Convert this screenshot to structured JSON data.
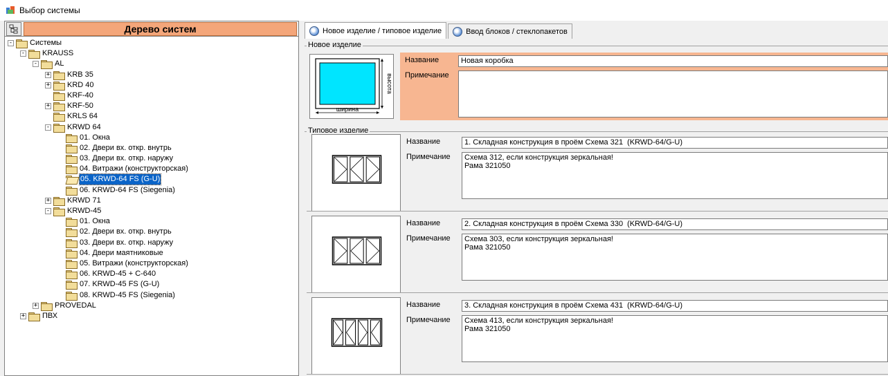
{
  "window": {
    "title": "Выбор системы"
  },
  "tree": {
    "header_title": "Дерево систем",
    "nodes": [
      {
        "label": "Системы",
        "depth": 0,
        "expander": "-",
        "folder": "closed"
      },
      {
        "label": "KRAUSS",
        "depth": 1,
        "expander": "-",
        "folder": "closed"
      },
      {
        "label": "AL",
        "depth": 2,
        "expander": "-",
        "folder": "closed"
      },
      {
        "label": "KRB 35",
        "depth": 3,
        "expander": "+",
        "folder": "closed"
      },
      {
        "label": "KRD 40",
        "depth": 3,
        "expander": "+",
        "folder": "closed"
      },
      {
        "label": "KRF-40",
        "depth": 3,
        "expander": "",
        "folder": "closed"
      },
      {
        "label": "KRF-50",
        "depth": 3,
        "expander": "+",
        "folder": "closed"
      },
      {
        "label": "KRLS 64",
        "depth": 3,
        "expander": "",
        "folder": "closed"
      },
      {
        "label": "KRWD 64",
        "depth": 3,
        "expander": "-",
        "folder": "closed"
      },
      {
        "label": "01. Окна",
        "depth": 4,
        "expander": "",
        "folder": "closed"
      },
      {
        "label": "02. Двери вх. откр. внутрь",
        "depth": 4,
        "expander": "",
        "folder": "closed"
      },
      {
        "label": "03. Двери вх. откр. наружу",
        "depth": 4,
        "expander": "",
        "folder": "closed"
      },
      {
        "label": "04. Витражи (конструкторская)",
        "depth": 4,
        "expander": "",
        "folder": "closed"
      },
      {
        "label": "05. KRWD-64 FS (G-U)",
        "depth": 4,
        "expander": "",
        "folder": "open",
        "selected": true
      },
      {
        "label": "06. KRWD-64 FS (Siegenia)",
        "depth": 4,
        "expander": "",
        "folder": "closed"
      },
      {
        "label": "KRWD 71",
        "depth": 3,
        "expander": "+",
        "folder": "closed"
      },
      {
        "label": "KRWD-45",
        "depth": 3,
        "expander": "-",
        "folder": "closed"
      },
      {
        "label": "01. Окна",
        "depth": 4,
        "expander": "",
        "folder": "closed"
      },
      {
        "label": "02. Двери вх. откр. внутрь",
        "depth": 4,
        "expander": "",
        "folder": "closed"
      },
      {
        "label": "03. Двери вх. откр. наружу",
        "depth": 4,
        "expander": "",
        "folder": "closed"
      },
      {
        "label": "04. Двери маятниковые",
        "depth": 4,
        "expander": "",
        "folder": "closed"
      },
      {
        "label": "05. Витражи (конструкторская)",
        "depth": 4,
        "expander": "",
        "folder": "closed"
      },
      {
        "label": "06. KRWD-45 + C-640",
        "depth": 4,
        "expander": "",
        "folder": "closed"
      },
      {
        "label": "07. KRWD-45 FS (G-U)",
        "depth": 4,
        "expander": "",
        "folder": "closed"
      },
      {
        "label": "08. KRWD-45 FS (Siegenia)",
        "depth": 4,
        "expander": "",
        "folder": "closed"
      },
      {
        "label": "PROVEDAL",
        "depth": 2,
        "expander": "+",
        "folder": "closed"
      },
      {
        "label": "ПВХ",
        "depth": 1,
        "expander": "+",
        "folder": "closed"
      }
    ]
  },
  "tabs": [
    {
      "label": "Новое изделие / типовое изделие",
      "active": true
    },
    {
      "label": "Ввод блоков / стеклопакетов",
      "active": false
    }
  ],
  "new_item": {
    "group_caption": "Новое изделие",
    "width_label": "ширина",
    "height_label": "высота",
    "name_label": "Название",
    "name_value": "Новая коробка",
    "note_label": "Примечание",
    "note_value": "",
    "form_color": "#f7b691",
    "glass_color": "#00e5ff"
  },
  "standard": {
    "group_caption": "Типовое изделие",
    "items": [
      {
        "name_label": "Название",
        "name_value": "1. Складная конструкция в проём Схема 321  (KRWD-64/G-U)",
        "note_label": "Примечание",
        "note_value": "Схема 312, если конструкция зеркальная!\nРама 321050"
      },
      {
        "name_label": "Название",
        "name_value": "2. Складная конструкция в проём Схема 330  (KRWD-64/G-U)",
        "note_label": "Примечание",
        "note_value": "Схема 303, если конструкция зеркальная!\nРама 321050"
      },
      {
        "name_label": "Название",
        "name_value": "3. Складная конструкция в проём Схема 431  (KRWD-64/G-U)",
        "note_label": "Примечание",
        "note_value": "Схема 413, если конструкция зеркальная!\nРама 321050"
      }
    ]
  }
}
